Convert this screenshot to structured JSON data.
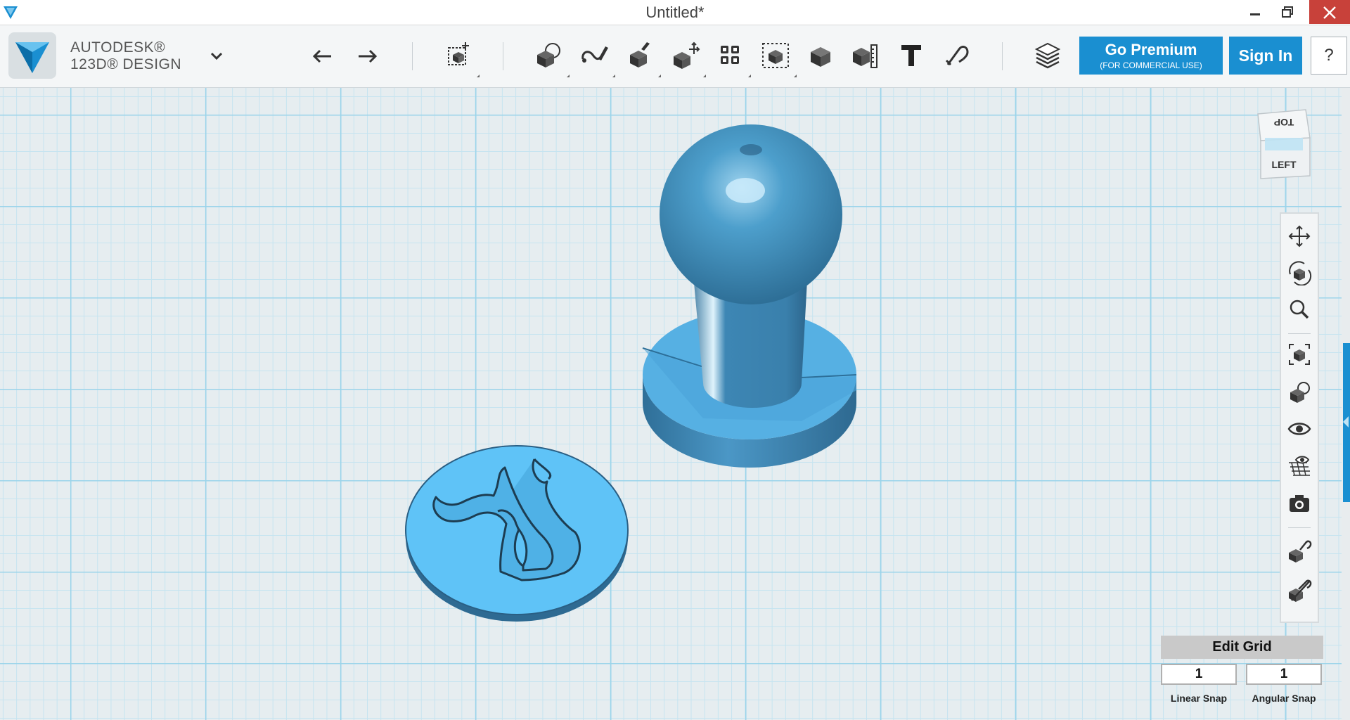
{
  "window": {
    "title": "Untitled*",
    "minimize_icon": "minimize-icon",
    "maximize_icon": "restore-icon",
    "close_icon": "close-icon"
  },
  "brand": {
    "line1": "AUTODESK®",
    "line2": "123D® DESIGN",
    "logo_color": "#1a8fd1"
  },
  "toolbar": {
    "icons": [
      "undo-icon",
      "redo-icon",
      "transform-icon",
      "primitives-icon",
      "sketch-icon",
      "construct-icon",
      "modify-icon",
      "pattern-icon",
      "grouping-icon",
      "combine-icon",
      "measure-icon",
      "text-icon",
      "snap-icon",
      "material-icon"
    ],
    "premium_label": "Go Premium",
    "premium_sub": "(FOR COMMERCIAL USE)",
    "signin_label": "Sign In",
    "help_label": "?"
  },
  "viewcube": {
    "top_label": "TOP",
    "left_label": "LEFT"
  },
  "navbar": {
    "icons": [
      "pan-icon",
      "orbit-icon",
      "zoom-icon",
      "fit-icon",
      "view-mode-icon",
      "visibility-icon",
      "grid-visibility-icon",
      "screenshot-icon",
      "snap-materials-icon",
      "hide-icon"
    ]
  },
  "edit_grid": {
    "title": "Edit Grid",
    "linear_snap_value": "1",
    "angular_snap_value": "1",
    "linear_snap_label": "Linear Snap",
    "angular_snap_label": "Angular Snap"
  },
  "colors": {
    "accent": "#1a8fd1",
    "model_dark": "#3a87b3",
    "model_light": "#5fc3f7",
    "grid_major": "#9bd4ea",
    "grid_minor": "#c6e4f0",
    "close_button": "#c8413a"
  }
}
